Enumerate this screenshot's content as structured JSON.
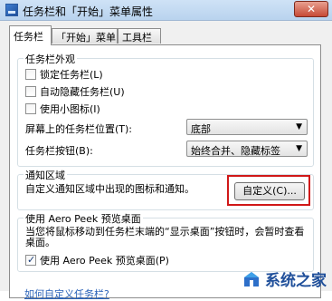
{
  "window": {
    "title": "任务栏和「开始」菜单属性",
    "close_label": "✕"
  },
  "tabs": [
    "任务栏",
    "「开始」菜单",
    "工具栏"
  ],
  "appearance": {
    "title": "任务栏外观",
    "lock_taskbar": {
      "label": "锁定任务栏(L)",
      "checked": false
    },
    "auto_hide": {
      "label": "自动隐藏任务栏(U)",
      "checked": false
    },
    "small_icons": {
      "label": "使用小图标(I)",
      "checked": false
    },
    "location": {
      "label": "屏幕上的任务栏位置(T):",
      "value": "底部"
    },
    "buttons": {
      "label": "任务栏按钮(B):",
      "value": "始终合并、隐藏标签"
    }
  },
  "notification": {
    "title": "通知区域",
    "description": "自定义通知区域中出现的图标和通知。",
    "customize_label": "自定义(C)..."
  },
  "aero_peek": {
    "title": "使用 Aero Peek 预览桌面",
    "description": "当您将鼠标移动到任务栏末端的“显示桌面”按钮时，会暂时查看桌面。",
    "checkbox": {
      "label": "使用 Aero Peek 预览桌面(P)",
      "checked": true
    }
  },
  "footer_link": "如何自定义任务栏?",
  "watermark": {
    "text": "系统之家"
  }
}
